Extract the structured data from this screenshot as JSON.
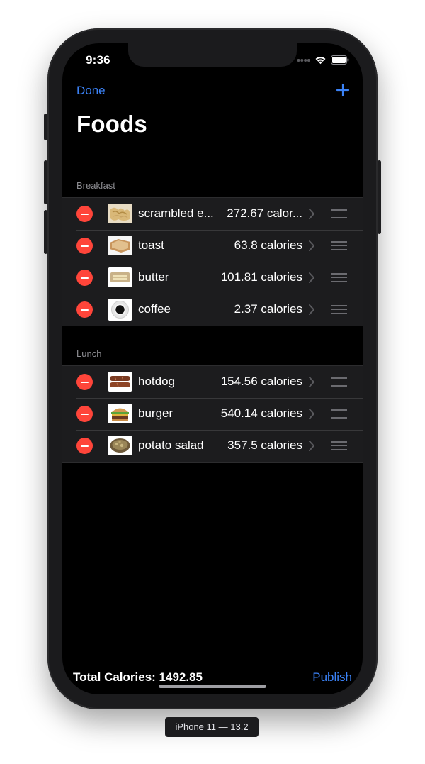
{
  "status_bar": {
    "time": "9:36"
  },
  "nav": {
    "done_label": "Done"
  },
  "page": {
    "title": "Foods"
  },
  "sections": [
    {
      "header": "Breakfast",
      "items": [
        {
          "name": "scrambled e...",
          "calories": "272.67 calor...",
          "thumb": "scrambled-eggs-thumbnail"
        },
        {
          "name": "toast",
          "calories": "63.8 calories",
          "thumb": "toast-thumbnail"
        },
        {
          "name": "butter",
          "calories": "101.81 calories",
          "thumb": "butter-thumbnail"
        },
        {
          "name": "coffee",
          "calories": "2.37 calories",
          "thumb": "coffee-thumbnail"
        }
      ]
    },
    {
      "header": "Lunch",
      "items": [
        {
          "name": "hotdog",
          "calories": "154.56 calories",
          "thumb": "hotdog-thumbnail"
        },
        {
          "name": "burger",
          "calories": "540.14 calories",
          "thumb": "burger-thumbnail"
        },
        {
          "name": "potato salad",
          "calories": "357.5 calories",
          "thumb": "potato-salad-thumbnail"
        }
      ]
    }
  ],
  "footer": {
    "total_label": "Total Calories: 1492.85",
    "publish_label": "Publish"
  },
  "device": {
    "label": "iPhone 11 — 13.2"
  },
  "colors": {
    "accent": "#3b82f6",
    "delete": "#ff453a",
    "background": "#000000",
    "cell": "#1c1c1e"
  }
}
